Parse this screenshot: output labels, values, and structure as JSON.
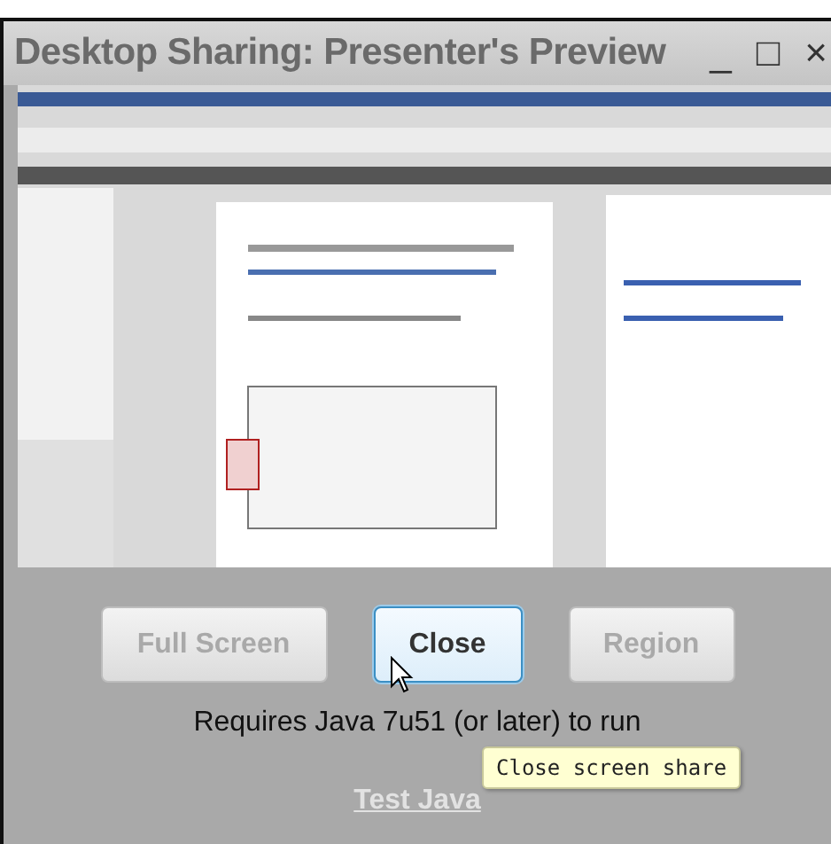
{
  "window": {
    "title": "Desktop Sharing: Presenter's Preview",
    "controls": [
      "_",
      "□",
      "×"
    ]
  },
  "buttons": [
    {
      "label": "Full Screen",
      "disabled": true,
      "hovered": false
    },
    {
      "label": "Close",
      "disabled": false,
      "hovered": true
    },
    {
      "label": "Region",
      "disabled": true,
      "hovered": false
    }
  ],
  "requirement": "Requires Java 7u51 (or later) to run",
  "link": "Test Java",
  "tooltip": "Close screen share"
}
